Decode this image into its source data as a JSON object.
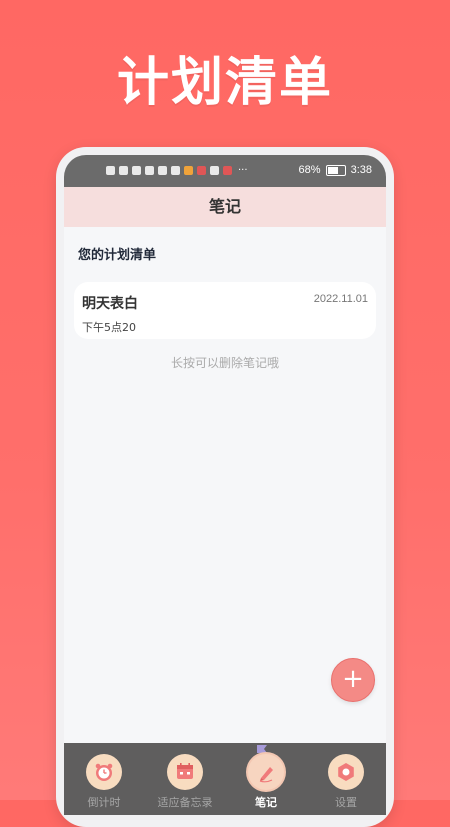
{
  "promo": {
    "title": "计划清单"
  },
  "status_bar": {
    "battery": "68%",
    "time": "3:38",
    "more": "···"
  },
  "header": {
    "title": "笔记"
  },
  "list": {
    "title": "您的计划清单"
  },
  "notes": [
    {
      "title": "明天表白",
      "date": "2022.11.01",
      "time": "下午5点20"
    }
  ],
  "hint": "长按可以删除笔记哦",
  "fab": {
    "label": "+"
  },
  "tabs": [
    {
      "label": "倒计时",
      "icon": "alarm-clock-icon"
    },
    {
      "label": "适应备忘录",
      "icon": "calendar-icon"
    },
    {
      "label": "笔记",
      "icon": "pen-icon",
      "active": true
    },
    {
      "label": "设置",
      "icon": "gear-icon"
    }
  ],
  "colors": {
    "accent": "#ff6863",
    "header_bg": "#f6dedd",
    "tabbar_bg": "#5f5e5e",
    "fab": "#f48a86"
  }
}
